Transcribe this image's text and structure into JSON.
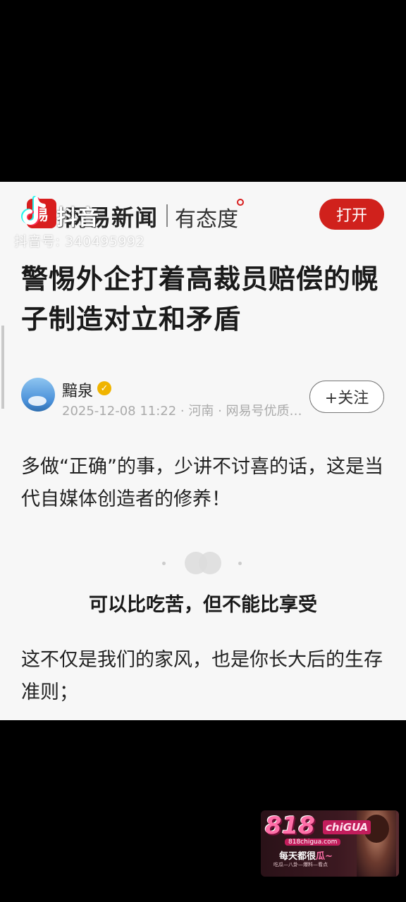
{
  "header": {
    "brand_logo_text": "易",
    "brand_name": "网易新闻",
    "brand_slogan": "有态度",
    "open_button_label": "打开"
  },
  "watermark": {
    "app_name": "抖音",
    "account_id": "抖音号: 340495992"
  },
  "article": {
    "title": "警惕外企打着高裁员赔偿的幌子制造对立和矛盾",
    "author": {
      "name": "黯泉",
      "meta": "2025-12-08 11:22 · 河南 · 网易号优质…"
    },
    "follow_button_label": "+关注",
    "paragraph_1": "多做“正确”的事，少讲不讨喜的话，这是当代自媒体创造者的修养！",
    "section_heading": "可以比吃苦，但不能比享受",
    "paragraph_2": "这不仅是我们的家风，也是你长大后的生存准则；"
  },
  "ad": {
    "logo": "818",
    "logo_suffix": "chiGUA",
    "url": "818chigua.com",
    "slogan_prefix": "每天都很",
    "slogan_highlight": "瓜~",
    "sub": "吃瓜—八卦—爆料—看点"
  },
  "colors": {
    "brand_red": "#d0211c",
    "verified_gold": "#f0b400"
  }
}
